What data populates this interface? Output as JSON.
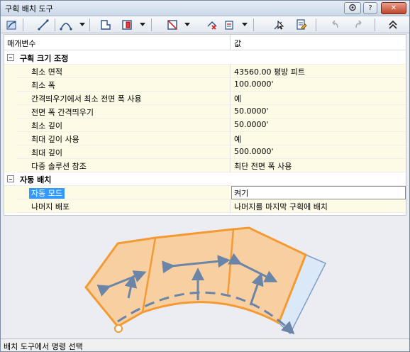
{
  "window": {
    "title": "구획 배치 도구",
    "help_label": "?",
    "close_label": "✕"
  },
  "toolbar": {
    "tools": [
      "layout-tool-icon",
      "line-icon",
      "arc-icon",
      "polygon-icon",
      "parcel-icon",
      "frontage-icon",
      "delete-icon",
      "select-icon",
      "properties-icon",
      "undo-icon",
      "redo-icon",
      "collapse-icon"
    ]
  },
  "grid": {
    "header": {
      "param": "매개변수",
      "value": "값"
    },
    "categories": [
      {
        "label": "구획 크기 조정",
        "rows": [
          {
            "name": "최소 면적",
            "value": "43560.00 평방 피트"
          },
          {
            "name": "최소 폭",
            "value": "100.0000'"
          },
          {
            "name": "간격띄우기에서 최소 전면 폭 사용",
            "value": "예"
          },
          {
            "name": "전면 폭 간격띄우기",
            "value": "50.0000'"
          },
          {
            "name": "최소 깊이",
            "value": "50.0000'"
          },
          {
            "name": "최대 깊이 사용",
            "value": "예"
          },
          {
            "name": "최대 깊이",
            "value": "500.0000'"
          },
          {
            "name": "다중 솔루션 참조",
            "value": "최단 전면 폭 사용"
          }
        ]
      },
      {
        "label": "자동 배치",
        "rows": [
          {
            "name": "자동 모드",
            "value": "켜기"
          },
          {
            "name": "나머지 배포",
            "value": "나머지를 마지막 구획에 배치"
          }
        ]
      }
    ]
  },
  "colors": {
    "parcel_fill": "#f8cfa0",
    "parcel_outline": "#f39a33",
    "remainder_fill": "#dbe8f7",
    "arrow": "#6b85a8"
  },
  "status_text": "배치 도구에서 명령 선택"
}
